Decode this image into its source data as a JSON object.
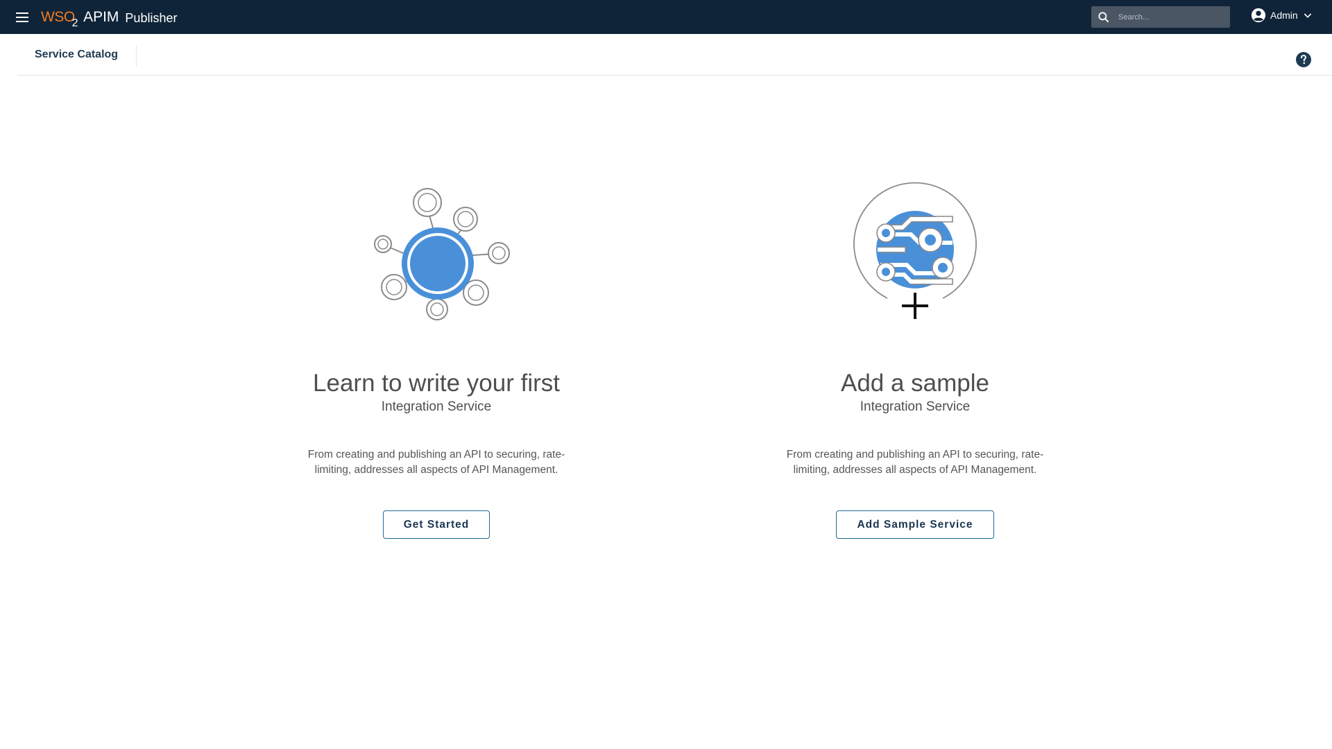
{
  "header": {
    "logo_text": "WSO",
    "logo_subscript": "2",
    "product": "APIM",
    "app_name": "Publisher",
    "search_placeholder": "Search...",
    "user_name": "Admin"
  },
  "subheader": {
    "breadcrumb": "Service Catalog"
  },
  "cards": [
    {
      "title": "Learn to write your first",
      "subtitle": "Integration Service",
      "description": "From creating and publishing an API to securing, rate-limiting, addresses all aspects of API Management.",
      "button_label": "Get Started",
      "icon": "network-hub-illustration"
    },
    {
      "title": "Add a sample",
      "subtitle": "Integration Service",
      "description": "From creating and publishing an API to securing, rate-limiting, addresses all aspects of API Management.",
      "button_label": "Add Sample Service",
      "icon": "circuit-add-illustration"
    }
  ],
  "colors": {
    "appbar": "#0f2438",
    "accent_orange": "#f47b20",
    "illustration_blue": "#4a90d9",
    "button_border": "#1d6a96",
    "breadcrumb_text": "#1d3a52"
  }
}
